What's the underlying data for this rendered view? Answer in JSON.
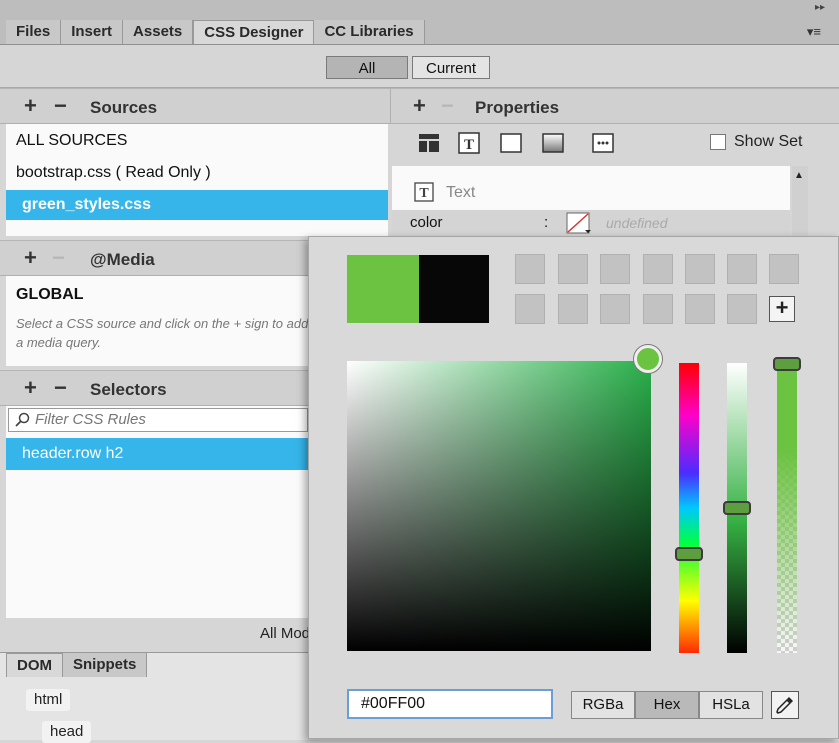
{
  "tabs": [
    "Files",
    "Insert",
    "Assets",
    "CSS Designer",
    "CC Libraries"
  ],
  "active_tab": "CSS Designer",
  "toggle": {
    "all": "All",
    "current": "Current"
  },
  "sources": {
    "title": "Sources",
    "items": [
      "ALL SOURCES",
      "bootstrap.css  ( Read Only )",
      "green_styles.css"
    ],
    "selected": "green_styles.css"
  },
  "properties": {
    "title": "Properties",
    "show_set": "Show Set",
    "section_text": "Text",
    "prop_name": "color",
    "prop_sep": ":",
    "prop_value": "undefined"
  },
  "media": {
    "title": "@Media",
    "global": "GLOBAL",
    "hint": "Select a CSS source and click on the + sign to add a media query."
  },
  "selectors": {
    "title": "Selectors",
    "filter_placeholder": "Filter CSS Rules",
    "items": [
      "header.row h2"
    ],
    "footer": "All Mode: Lists rules for entire document"
  },
  "bottom_tabs": [
    "DOM",
    "Snippets"
  ],
  "dom_tree": [
    "html",
    "head"
  ],
  "color_picker": {
    "hex_value": "#00FF00",
    "formats": [
      "RGBa",
      "Hex",
      "HSLa"
    ],
    "active_format": "Hex",
    "new_color": "#6cc241",
    "old_color": "#070707",
    "swatch_add": "+",
    "hue_level": 0.33,
    "saturation_level": 0.45,
    "alpha_level": 0.0
  },
  "colors": {
    "selection": "#35b5ea",
    "accent_green": "#6cc241"
  }
}
